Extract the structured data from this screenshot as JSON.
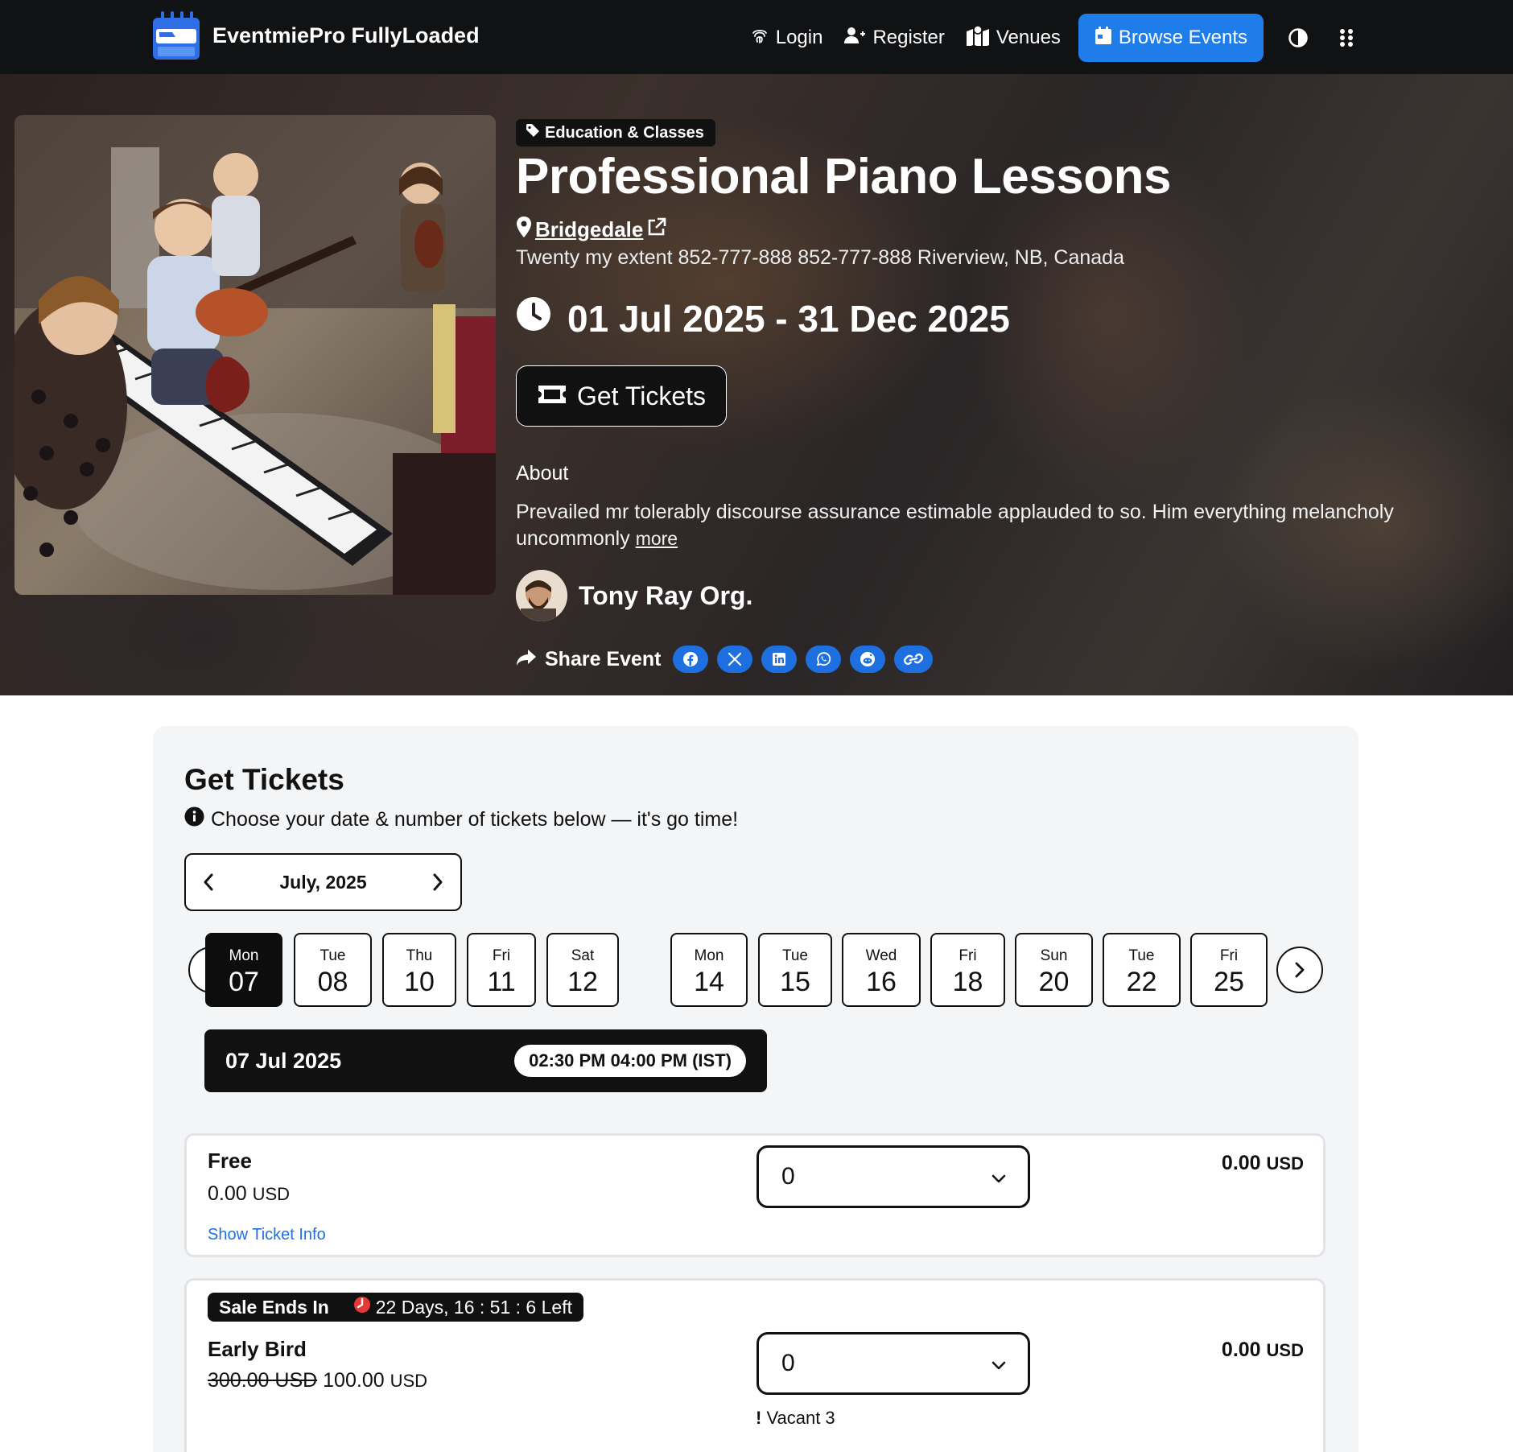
{
  "nav": {
    "brand": "EventmiePro FullyLoaded",
    "login": "Login",
    "register": "Register",
    "venues": "Venues",
    "browse_events": "Browse Events"
  },
  "event": {
    "category": "Education & Classes",
    "title": "Professional Piano Lessons",
    "venue": "Bridgedale",
    "address": "Twenty my extent 852-777-888 852-777-888 Riverview, NB, Canada",
    "dates": "01 Jul 2025 - 31 Dec 2025",
    "get_tickets": "Get Tickets",
    "about_heading": "About",
    "about_text": "Prevailed mr tolerably discourse assurance estimable applauded to so. Him everything melancholy uncommonly",
    "more": "more",
    "organizer": "Tony Ray Org.",
    "share_label": "Share Event"
  },
  "tickets": {
    "title": "Get Tickets",
    "subtitle": "Choose your date & number of tickets below — it's go time!",
    "month": "July, 2025",
    "days": [
      {
        "name": "Mon",
        "num": "07"
      },
      {
        "name": "Tue",
        "num": "08"
      },
      {
        "name": "Thu",
        "num": "10"
      },
      {
        "name": "Fri",
        "num": "11"
      },
      {
        "name": "Sat",
        "num": "12"
      },
      {
        "name": "Mon",
        "num": "14"
      },
      {
        "name": "Tue",
        "num": "15"
      },
      {
        "name": "Wed",
        "num": "16"
      },
      {
        "name": "Fri",
        "num": "18"
      },
      {
        "name": "Sun",
        "num": "20"
      },
      {
        "name": "Tue",
        "num": "22"
      },
      {
        "name": "Fri",
        "num": "25"
      }
    ],
    "selected_date": "07 Jul 2025",
    "selected_time": "02:30 PM 04:00 PM (IST)",
    "items": [
      {
        "name": "Free",
        "price": "0.00",
        "currency": "USD",
        "info_link": "Show Ticket Info",
        "qty": "0",
        "total": "0.00",
        "total_currency": "USD"
      },
      {
        "sale_label": "Sale Ends In",
        "sale_timer": "22 Days, 16 : 51 : 6 Left",
        "name": "Early Bird",
        "old_price": "300.00 USD",
        "price": "100.00",
        "currency": "USD",
        "qty": "0",
        "vacant": "Vacant 3",
        "total": "0.00",
        "total_currency": "USD"
      }
    ]
  },
  "colors": {
    "primary": "#1f7dea",
    "nav_bg": "#111214",
    "share_btn": "#1e6fe0",
    "timer_red": "#e53935"
  }
}
